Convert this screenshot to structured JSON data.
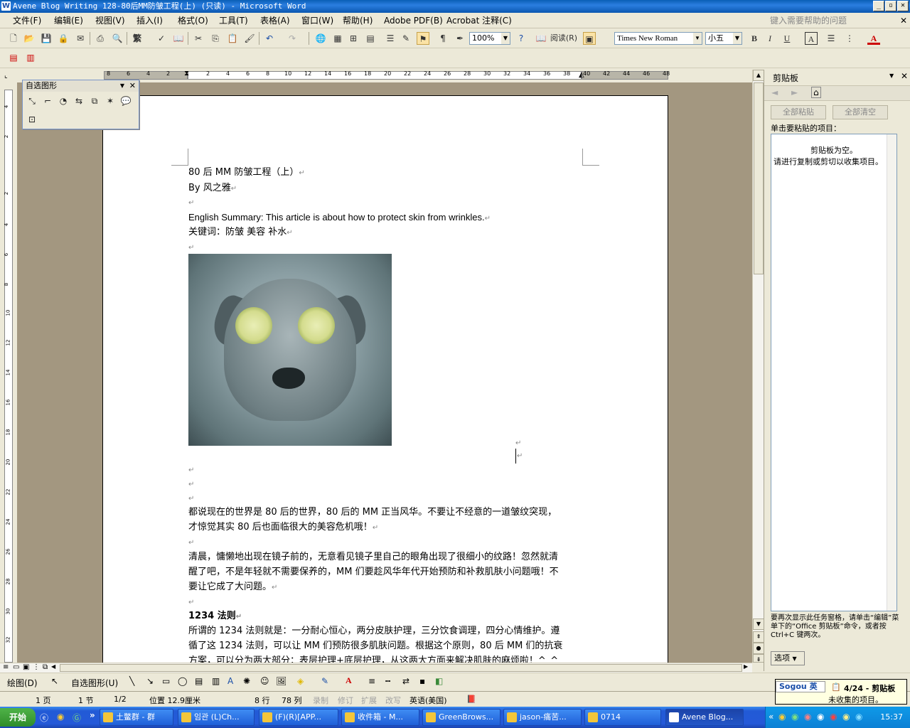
{
  "window": {
    "title": "Avene Blog Writing 128-80后MM防皱工程(上) (只读) - Microsoft Word",
    "icon_letter": "W",
    "min_icon": "minimize-icon",
    "max_icon": "maximize-icon",
    "close_icon": "close-icon",
    "min_glyph": "_",
    "max_glyph": "▫",
    "close_glyph": "✕"
  },
  "menu": {
    "items": [
      "文件(F)",
      "编辑(E)",
      "视图(V)",
      "插入(I)",
      "格式(O)",
      "工具(T)",
      "表格(A)",
      "窗口(W)",
      "帮助(H)",
      "Adobe PDF(B)",
      "Acrobat 注释(C)"
    ],
    "help_placeholder": "键入需要帮助的问题",
    "close_glyph": "✕"
  },
  "toolbar": {
    "zoom": "100%",
    "read_label": "阅读(R)",
    "font_name": "Times New Roman",
    "font_size": "小五",
    "bold": "B",
    "italic": "I",
    "underline": "U",
    "char_border": "A",
    "font_color": "A",
    "trad_chinese": "繁"
  },
  "autoshape_toolbar": {
    "title": "自选图形",
    "close_glyph": "✕"
  },
  "document": {
    "lines": [
      "80 后 MM 防皱工程（上）",
      "By  风之雅",
      "",
      "English Summary: This article is about how to protect skin from wrinkles.",
      "关键词：防皱    美容    补水"
    ],
    "body": [
      "都说现在的世界是 80 后的世界，80 后的 MM 正当风华。不要让不经意的一道皱纹突现，",
      "才惊觉其实 80 后也面临很大的美容危机哦！",
      "",
      "清晨，慵懒地出现在镜子前的，无意看见镜子里自己的眼角出现了很细小的纹路！忽然就清",
      "醒了吧，不是年轻就不需要保养的，MM 们要趁风华年代开始预防和补救肌肤小问题哦！不",
      "要让它成了大问题。",
      ""
    ],
    "heading2": "1234 法则",
    "body2": [
      "所谓的 1234 法则就是：一分耐心恒心，两分皮肤护理，三分饮食调理，四分心情维护。遵",
      "循了这 1234 法则，可以让 MM 们预防很多肌肤问题。根据这个原则，80 后 MM 们的抗衰",
      "方案，可以分为两大部分：表层护理+底层护理，从这两大方面来解决肌肤的麻烦啦！^_^"
    ],
    "para_mark": "↵"
  },
  "ruler": {
    "h_ticks": [
      "8",
      "6",
      "4",
      "2",
      "",
      "2",
      "4",
      "6",
      "8",
      "10",
      "12",
      "14",
      "16",
      "18",
      "20",
      "22",
      "24",
      "26",
      "28",
      "30",
      "32",
      "34",
      "36",
      "38",
      "40",
      "42",
      "44",
      "46",
      "48"
    ],
    "v_ticks": [
      "4",
      "2",
      "",
      "2",
      "4",
      "6",
      "8",
      "10",
      "12",
      "14",
      "16",
      "18",
      "20",
      "22",
      "24",
      "26",
      "28",
      "30",
      "32"
    ]
  },
  "taskpane": {
    "title": "剪贴板",
    "paste_all": "全部粘贴",
    "clear_all": "全部清空",
    "instruction": "单击要粘贴的项目：",
    "empty_line1": "剪贴板为空。",
    "empty_line2": "请进行复制或剪切以收集项目。",
    "footer": "要再次显示此任务窗格，请单击“编辑”菜单下的“Office 剪贴板”命令，或者按 Ctrl+C 键两次。",
    "options": "选项",
    "close_glyph": "✕"
  },
  "drawing_toolbar": {
    "draw_label": "绘图(D)",
    "autoshape_label": "自选图形(U)"
  },
  "status": {
    "page": "1 页",
    "section": "1 节",
    "pages": "1/2",
    "position": "位置 12.9厘米",
    "line": "8 行",
    "column": "78 列",
    "rec": "录制",
    "trk": "修订",
    "ext": "扩展",
    "ovr": "改写",
    "language": "英语(美国)"
  },
  "taskbar": {
    "start": "开始",
    "tasks": [
      "土鳖群 - 群",
      "임관 (L)Ch...",
      "(F)(R)[APP...",
      "收件箱 - M...",
      "GreenBrows...",
      "jason-痛苦...",
      "0714",
      "Avene Blog..."
    ],
    "clock": "15:37"
  },
  "notification": {
    "title": "4/24 - 剪贴板",
    "text": "未收集的项目。"
  },
  "ime": {
    "label": "Sogou 英"
  }
}
